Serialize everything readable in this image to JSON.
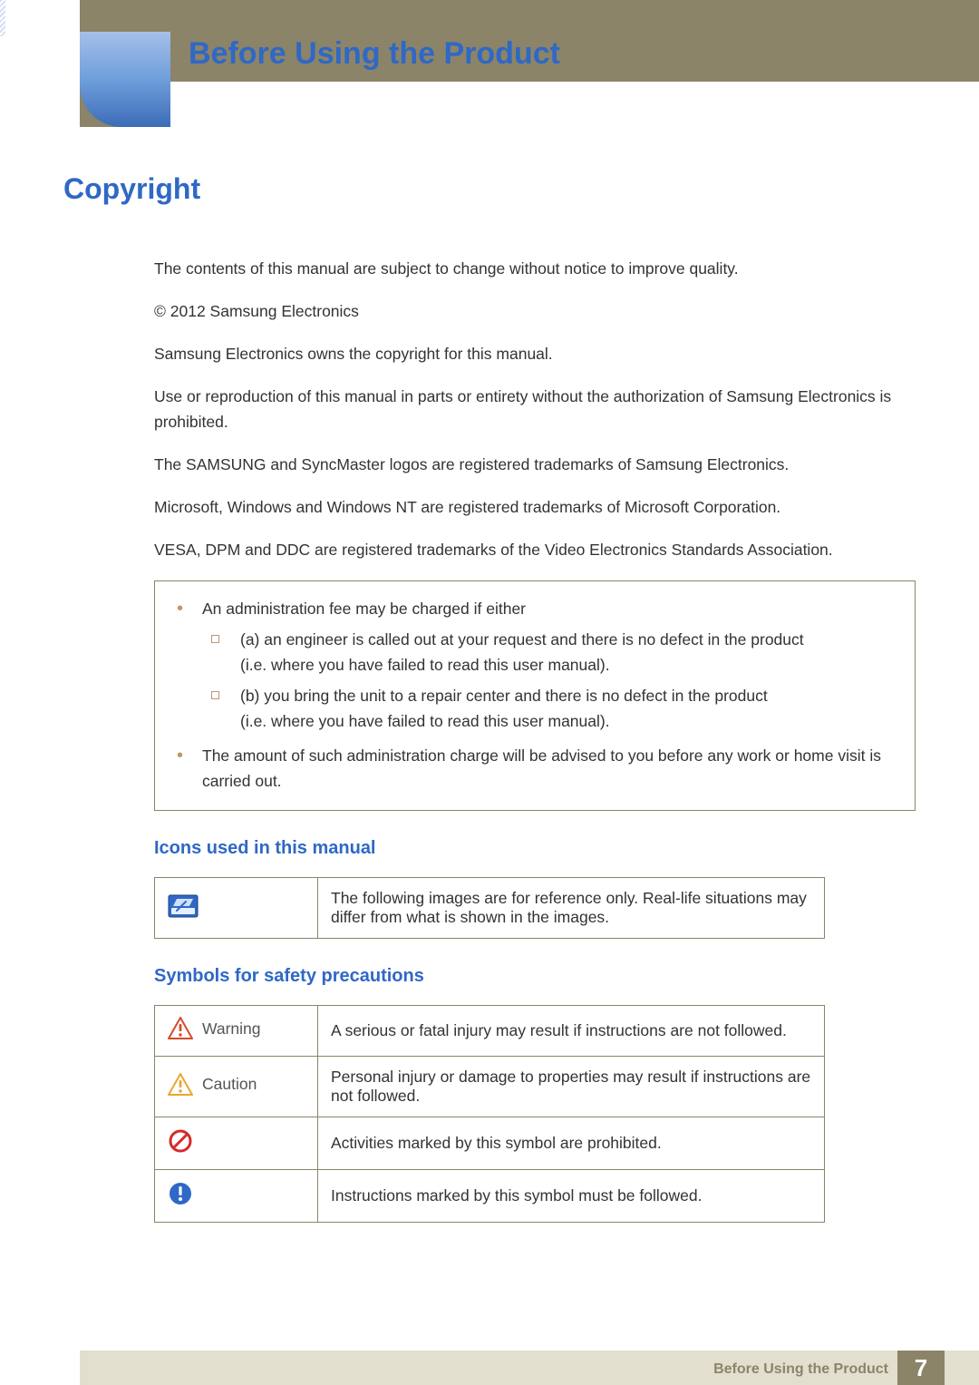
{
  "header": {
    "chapter_title": "Before Using the Product"
  },
  "section": {
    "title": "Copyright"
  },
  "paras": [
    "The contents of this manual are subject to change without notice to improve quality.",
    "© 2012 Samsung Electronics",
    "Samsung Electronics owns the copyright for this manual.",
    "Use or reproduction of this manual in parts or entirety without the authorization of Samsung Electronics is prohibited.",
    "The SAMSUNG and SyncMaster logos are registered trademarks of Samsung Electronics.",
    "Microsoft, Windows and Windows NT are registered trademarks of Microsoft Corporation.",
    "VESA, DPM and DDC are registered trademarks of the Video Electronics Standards Association."
  ],
  "infobox": {
    "l1a": "An administration fee may be charged if either",
    "l2a": "(a) an engineer is called out at your request and there is no defect in the product",
    "l2a_cont": "(i.e. where you have failed to read this user manual).",
    "l2b": "(b) you bring the unit to a repair center and there is no defect in the product",
    "l2b_cont": "(i.e. where you have failed to read this user manual).",
    "l1b": "The amount of such administration charge will be advised to you before any work or home visit is carried out."
  },
  "icons_heading": "Icons used in this manual",
  "icons_table": {
    "row1_text": "The following images are for reference only. Real-life situations may differ from what is shown in the images."
  },
  "symbols_heading": "Symbols for safety precautions",
  "symbols_table": {
    "warning_label": "Warning",
    "warning_text": "A serious or fatal injury may result if instructions are not followed.",
    "caution_label": "Caution",
    "caution_text": "Personal injury or damage to properties may result if instructions are not followed.",
    "prohibit_text": "Activities marked by this symbol are prohibited.",
    "must_text": "Instructions marked by this symbol must be followed."
  },
  "footer": {
    "label": "Before Using the Product",
    "page": "7"
  }
}
